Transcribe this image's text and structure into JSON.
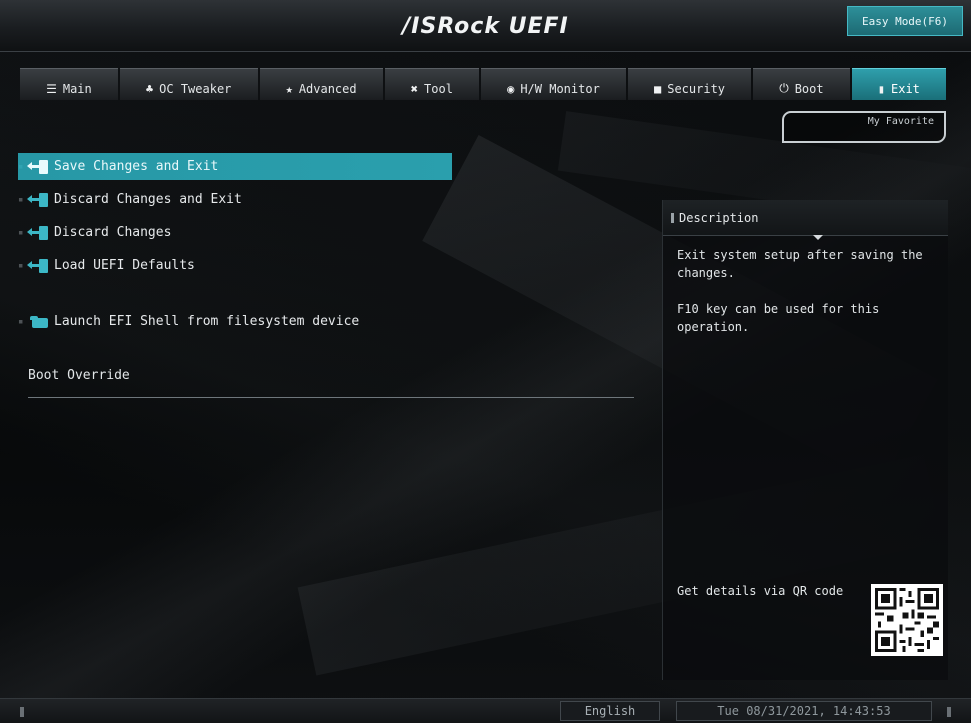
{
  "header": {
    "brand": "/ISRock UEFI",
    "easy_mode_label": "Easy Mode(F6)"
  },
  "tabs": [
    {
      "label": "Main",
      "icon": "list-icon",
      "glyph": "☰"
    },
    {
      "label": "OC Tweaker",
      "icon": "rocket-icon",
      "glyph": "♣"
    },
    {
      "label": "Advanced",
      "icon": "star-icon",
      "glyph": "★"
    },
    {
      "label": "Tool",
      "icon": "tools-icon",
      "glyph": "✖"
    },
    {
      "label": "H/W Monitor",
      "icon": "monitor-icon",
      "glyph": "◉"
    },
    {
      "label": "Security",
      "icon": "shield-icon",
      "glyph": "■"
    },
    {
      "label": "Boot",
      "icon": "power-icon",
      "glyph": "⏻"
    },
    {
      "label": "Exit",
      "icon": "exit-icon",
      "glyph": "▮"
    }
  ],
  "active_tab": "Exit",
  "my_favorite_label": "My Favorite",
  "menu": {
    "items": [
      {
        "label": "Save Changes and Exit",
        "selected": true
      },
      {
        "label": "Discard Changes and Exit",
        "selected": false
      },
      {
        "label": "Discard Changes",
        "selected": false
      },
      {
        "label": "Load UEFI Defaults",
        "selected": false
      },
      {
        "label": "Launch EFI Shell from filesystem device",
        "selected": false
      }
    ],
    "section_label": "Boot Override"
  },
  "description": {
    "title": "Description",
    "paragraphs": [
      "Exit system setup after saving the changes.",
      "F10 key can be used for this operation."
    ],
    "qr_label": "Get details via QR code"
  },
  "status_bar": {
    "language": "English",
    "datetime": "Tue 08/31/2021, 14:43:53"
  },
  "colors": {
    "accent": "#2a9fad",
    "background": "#07090a"
  }
}
